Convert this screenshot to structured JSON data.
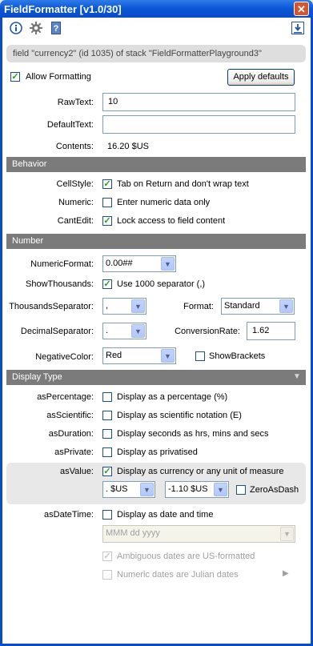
{
  "window": {
    "title": "FieldFormatter [v1.0/30]",
    "close_glyph": "✕"
  },
  "toolbar": {
    "icons": [
      "info-icon",
      "gear-icon",
      "help-icon",
      "download-icon"
    ],
    "info_glyph": "i",
    "help_glyph": "?",
    "download_glyph": "↓"
  },
  "path": "field \"currency2\" (id 1035) of stack \"FieldFormatterPlayground3\"",
  "allow_formatting": {
    "label": "Allow Formatting",
    "checked": true
  },
  "apply_defaults": "Apply defaults",
  "raw_text": {
    "label": "RawText:",
    "value": "10"
  },
  "default_text": {
    "label": "DefaultText:",
    "value": ""
  },
  "contents": {
    "label": "Contents:",
    "value": "16.20 $US"
  },
  "behavior": {
    "title": "Behavior",
    "cell_style": {
      "label": "CellStyle:",
      "text": "Tab on Return and don't wrap text",
      "checked": true
    },
    "numeric": {
      "label": "Numeric:",
      "text": "Enter numeric data only",
      "checked": false
    },
    "cant_edit": {
      "label": "CantEdit:",
      "text": "Lock access to field content",
      "checked": true
    }
  },
  "number": {
    "title": "Number",
    "numeric_format": {
      "label": "NumericFormat:",
      "value": "0.00##"
    },
    "show_thousands": {
      "label": "ShowThousands:",
      "text": "Use 1000 separator (,)",
      "checked": true
    },
    "thousands_separator": {
      "label": "ThousandsSeparator:",
      "value": ","
    },
    "format": {
      "label": "Format:",
      "value": "Standard"
    },
    "decimal_separator": {
      "label": "DecimalSeparator:",
      "value": "."
    },
    "conversion_rate": {
      "label": "ConversionRate:",
      "value": "1.62"
    },
    "negative_color": {
      "label": "NegativeColor:",
      "value": "Red"
    },
    "show_brackets": {
      "text": "ShowBrackets",
      "checked": false
    }
  },
  "display_type": {
    "title": "Display Type",
    "collapse_glyph": "▼",
    "as_percentage": {
      "label": "asPercentage:",
      "text": "Display as a percentage (%)",
      "checked": false
    },
    "as_scientific": {
      "label": "asScientific:",
      "text": "Display as scientific notation (E)",
      "checked": false
    },
    "as_duration": {
      "label": "asDuration:",
      "text": "Display seconds as hrs, mins and secs",
      "checked": false
    },
    "as_private": {
      "label": "asPrivate:",
      "text": "Display as privatised",
      "checked": false
    },
    "as_value": {
      "label": "asValue:",
      "text": "Display as currency or any unit of measure",
      "checked": true
    },
    "currency_unit": ". $US",
    "currency_sample": "-1.10 $US",
    "zero_as_dash": {
      "text": "ZeroAsDash",
      "checked": false
    },
    "as_datetime": {
      "label": "asDateTime:",
      "text": "Display as date and time",
      "checked": false
    },
    "date_format": "MMM dd yyyy",
    "ambiguous_dates": {
      "text": "Ambiguous dates are US-formatted",
      "checked": true
    },
    "julian_dates": {
      "text": "Numeric dates are Julian dates",
      "checked": false
    },
    "more_glyph": "▶"
  },
  "check_glyph": "✓",
  "colors": {
    "title_bar": "#0b56d6",
    "section_header": "#7b7b7b",
    "close_button": "#d9532f"
  }
}
